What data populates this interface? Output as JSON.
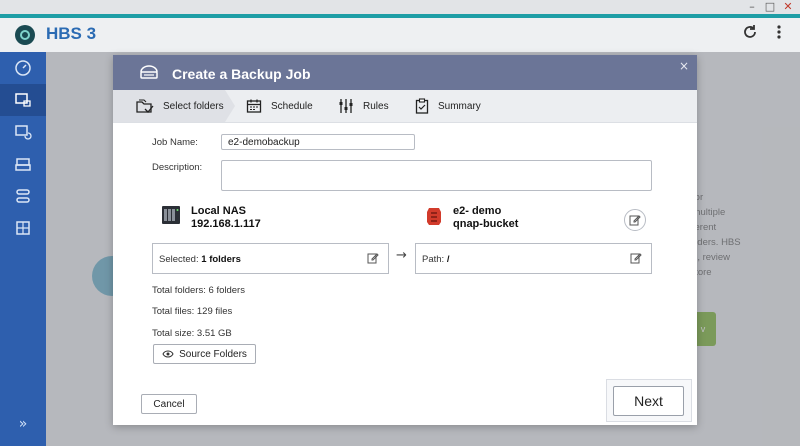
{
  "app": {
    "title": "HBS 3"
  },
  "window_controls": [
    "–",
    "□",
    "✕"
  ],
  "header_icons": [
    "refresh-icon",
    "more-icon"
  ],
  "sidebar": {
    "items": [
      "overview-icon",
      "backup-icon",
      "sync-icon",
      "restore-icon",
      "storage-icon",
      "services-icon"
    ],
    "active": 1,
    "collapse_glyph": "»"
  },
  "background": {
    "text_lines": [
      "le for",
      "te multiple",
      "different",
      "roviders. HBS",
      "obs, review",
      "restore"
    ],
    "green_button": "v"
  },
  "dialog": {
    "title": "Create a Backup Job",
    "close": "×",
    "steps": [
      {
        "label": "Select folders",
        "active": true
      },
      {
        "label": "Schedule",
        "active": false
      },
      {
        "label": "Rules",
        "active": false
      },
      {
        "label": "Summary",
        "active": false
      }
    ],
    "job_name_label": "Job Name:",
    "job_name_value": "e2-demobackup",
    "description_label": "Description:",
    "description_value": "",
    "source": {
      "name": "Local NAS",
      "address": "192.168.1.117"
    },
    "destination": {
      "name": "e2- demo",
      "bucket": "qnap-bucket"
    },
    "arrow": "→",
    "selected_prefix": "Selected:",
    "selected_value": "1 folders",
    "path_prefix": "Path:",
    "path_value": "/",
    "stats": [
      {
        "label": "Total folders:",
        "value": "6 folders"
      },
      {
        "label": "Total files:",
        "value": "129 files"
      },
      {
        "label": "Total size:",
        "value": "3.51 GB"
      }
    ],
    "source_folders_button": "Source Folders",
    "cancel_button": "Cancel",
    "next_button": "Next"
  },
  "colors": {
    "accent": "#1e9ea6",
    "sidebar": "#2e5fae",
    "dialog_header": "#6b7597",
    "title": "#2b6bb3"
  }
}
